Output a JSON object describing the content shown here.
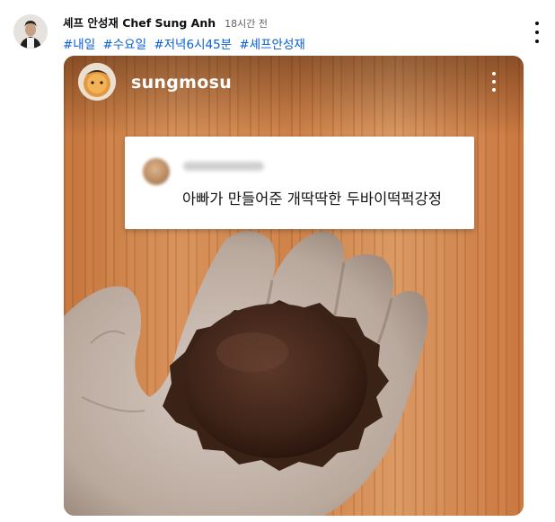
{
  "post": {
    "author": "셰프 안성재 Chef Sung Anh",
    "time": "18시간 전",
    "hashtags": [
      "#내일",
      "#수요일",
      "#저녁6시45분",
      "#셰프안성재"
    ]
  },
  "media": {
    "username": "sungmosu",
    "comment_text": "아빠가 만들어준 개딱딱한 두바이떡퍽강정"
  },
  "icons": {
    "post_menu": "more-vert-icon",
    "media_menu": "more-vert-icon"
  },
  "colors": {
    "hashtag": "#065fd4",
    "wood": "#d08a52",
    "chocolate": "#4a2a1c"
  }
}
